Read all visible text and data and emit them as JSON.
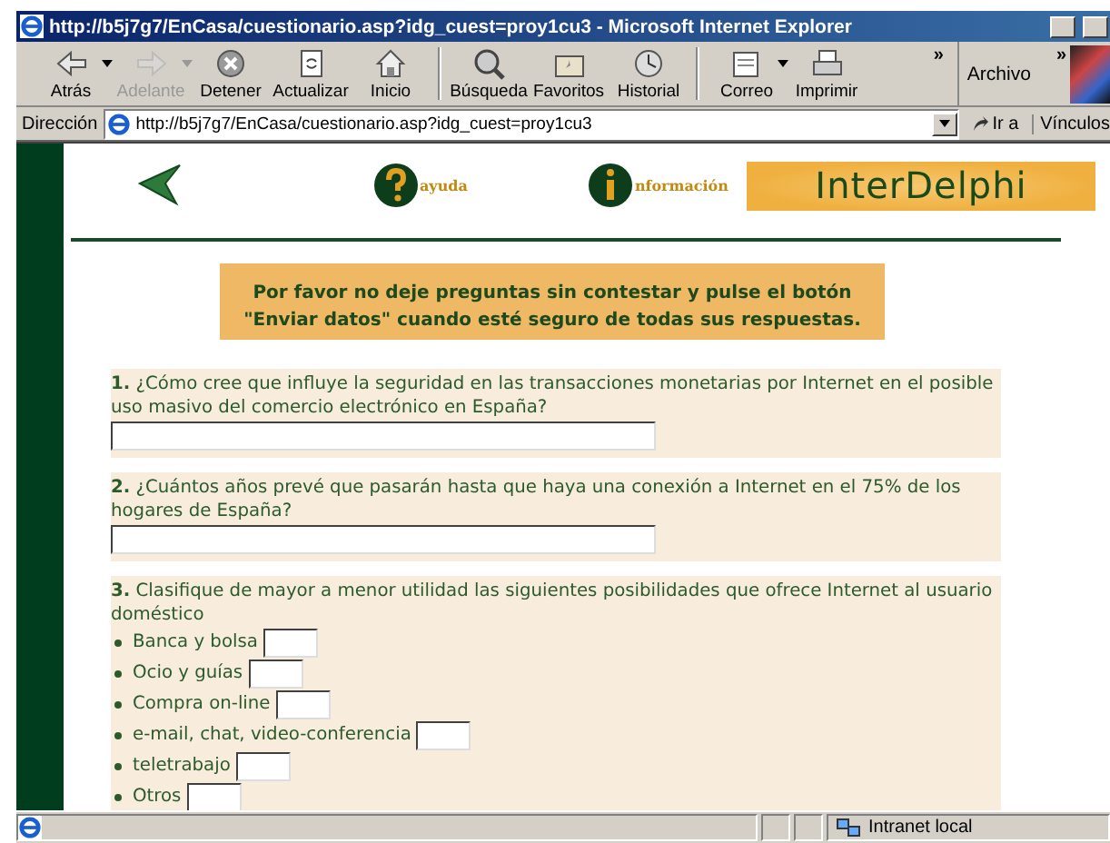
{
  "window": {
    "title": "http://b5j7g7/EnCasa/cuestionario.asp?idg_cuest=proy1cu3 - Microsoft Internet Explorer"
  },
  "toolbar": {
    "buttons": [
      {
        "kind": "back",
        "label": "Atrás",
        "disabled": false,
        "menu": true
      },
      {
        "kind": "forward",
        "label": "Adelante",
        "disabled": true,
        "menu": true
      },
      {
        "kind": "stop",
        "label": "Detener",
        "disabled": false,
        "menu": false
      },
      {
        "kind": "refresh",
        "label": "Actualizar",
        "disabled": false,
        "menu": false
      },
      {
        "kind": "home",
        "label": "Inicio",
        "disabled": false,
        "menu": false
      },
      {
        "kind": "separator"
      },
      {
        "kind": "search",
        "label": "Búsqueda",
        "disabled": false,
        "menu": false
      },
      {
        "kind": "favorites",
        "label": "Favoritos",
        "disabled": false,
        "menu": false
      },
      {
        "kind": "history",
        "label": "Historial",
        "disabled": false,
        "menu": false
      },
      {
        "kind": "separator"
      },
      {
        "kind": "mail",
        "label": "Correo",
        "disabled": false,
        "menu": true
      },
      {
        "kind": "print",
        "label": "Imprimir",
        "disabled": false,
        "menu": false
      }
    ],
    "overflow": "»",
    "menu_label": "Archivo",
    "menu_overflow": "»"
  },
  "address_bar": {
    "label": "Dirección",
    "url": "http://b5j7g7/EnCasa/cuestionario.asp?idg_cuest=proy1cu3",
    "go": "Ir a",
    "links": "Vínculos"
  },
  "page": {
    "nav": {
      "help": "ayuda",
      "info": "nformación"
    },
    "logo": "InterDelphi",
    "notice": [
      "Por favor no deje preguntas sin contestar y pulse el botón",
      "\"Enviar datos\" cuando esté seguro de todas sus respuestas."
    ],
    "questions": [
      {
        "kind": "text",
        "number": "1.",
        "text": "¿Cómo cree que influye la seguridad en las transacciones monetarias por Internet en el posible uso masivo del comercio electrónico en España?"
      },
      {
        "kind": "text",
        "number": "2.",
        "text": "¿Cuántos años prevé que pasarán hasta que haya una conexión a Internet en el 75% de los hogares de España?"
      },
      {
        "kind": "ranking",
        "number": "3.",
        "text": "Clasifique de mayor a menor utilidad las siguientes posibilidades que ofrece Internet al usuario doméstico",
        "options": [
          "Banca y bolsa",
          "Ocio y guías",
          "Compra on-line",
          "e-mail, chat, video-conferencia",
          "teletrabajo",
          "Otros"
        ]
      }
    ]
  },
  "status_bar": {
    "zone": "Intranet local"
  }
}
